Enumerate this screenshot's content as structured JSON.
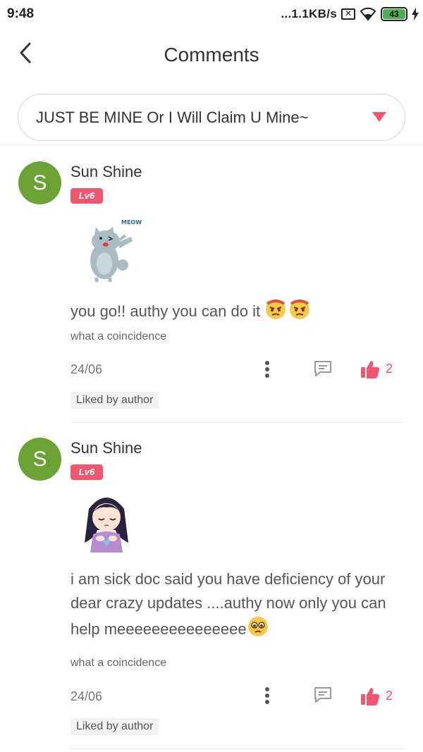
{
  "status_bar": {
    "time": "9:48",
    "network_speed": "...1.1KB/s",
    "sim_label": "✕",
    "battery": "43"
  },
  "header": {
    "title": "Comments",
    "back_icon": "back-arrow-icon"
  },
  "story_select": {
    "value": "JUST BE MINE Or I Will Claim U Mine~",
    "caret_icon": "caret-down-icon",
    "caret_color": "#f0566e"
  },
  "colors": {
    "accent": "#f0566e",
    "avatar_bg": "#6aa333"
  },
  "comments": [
    {
      "avatar_letter": "S",
      "user": "Sun Shine",
      "level": "Lv6",
      "sticker_label": "MEOW",
      "text": "you go!! authy you can do it ",
      "reply_to": "what a coincidence",
      "date": "24/06",
      "likes": "2",
      "liked_tag": "Liked by author"
    },
    {
      "avatar_letter": "S",
      "user": "Sun Shine",
      "level": "Lv6",
      "text": "i am sick doc said you have deficiency of your dear crazy updates ....authy now only you can help meeeeeeeeeeeeeee",
      "reply_to": "what a coincidence",
      "date": "24/06",
      "likes": "2",
      "liked_tag": "Liked by author"
    }
  ]
}
